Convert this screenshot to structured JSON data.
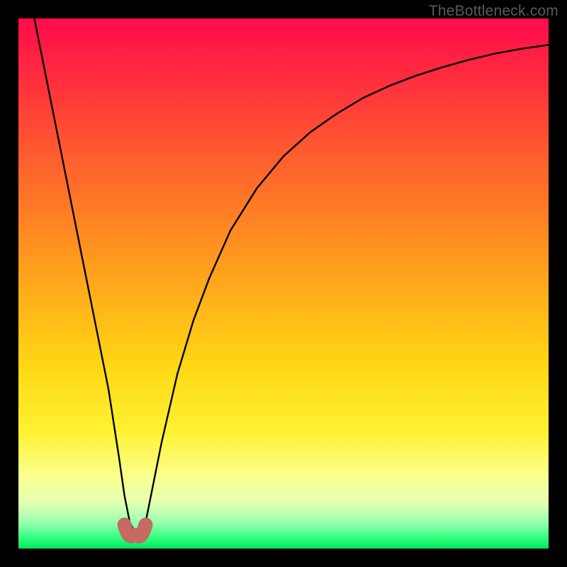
{
  "attribution": "TheBottleneck.com",
  "chart_data": {
    "type": "line",
    "title": "",
    "xlabel": "",
    "ylabel": "",
    "xlim": [
      0,
      100
    ],
    "ylim": [
      0,
      100
    ],
    "grid": false,
    "legend": false,
    "series": [
      {
        "name": "bottleneck-curve",
        "color": "#000000",
        "x": [
          3,
          5,
          7,
          9,
          11,
          13,
          15,
          17,
          19,
          20,
          21,
          22,
          23,
          24,
          25,
          27,
          30,
          33,
          36,
          40,
          45,
          50,
          55,
          60,
          65,
          70,
          75,
          80,
          85,
          90,
          95,
          100
        ],
        "y": [
          100,
          90,
          80,
          70,
          60,
          50,
          40,
          30,
          17,
          10,
          5,
          3,
          3,
          5,
          10,
          20,
          33,
          43,
          51,
          60,
          68,
          74,
          78.5,
          82,
          85,
          87.3,
          89.2,
          90.8,
          92.2,
          93.4,
          94.3,
          95
        ]
      },
      {
        "name": "marker-points",
        "color": "#c66a62",
        "type": "scatter",
        "x": [
          20,
          21.6,
          22.4,
          24
        ],
        "y": [
          4.5,
          2.5,
          2.5,
          4.5
        ]
      }
    ],
    "background_gradient": {
      "orientation": "vertical",
      "stops": [
        {
          "pos": 0.0,
          "color": "#ff0b4b"
        },
        {
          "pos": 0.25,
          "color": "#ff5a2f"
        },
        {
          "pos": 0.52,
          "color": "#ffae1a"
        },
        {
          "pos": 0.78,
          "color": "#fff233"
        },
        {
          "pos": 0.91,
          "color": "#e7ffb0"
        },
        {
          "pos": 1.0,
          "color": "#00e85e"
        }
      ]
    }
  }
}
